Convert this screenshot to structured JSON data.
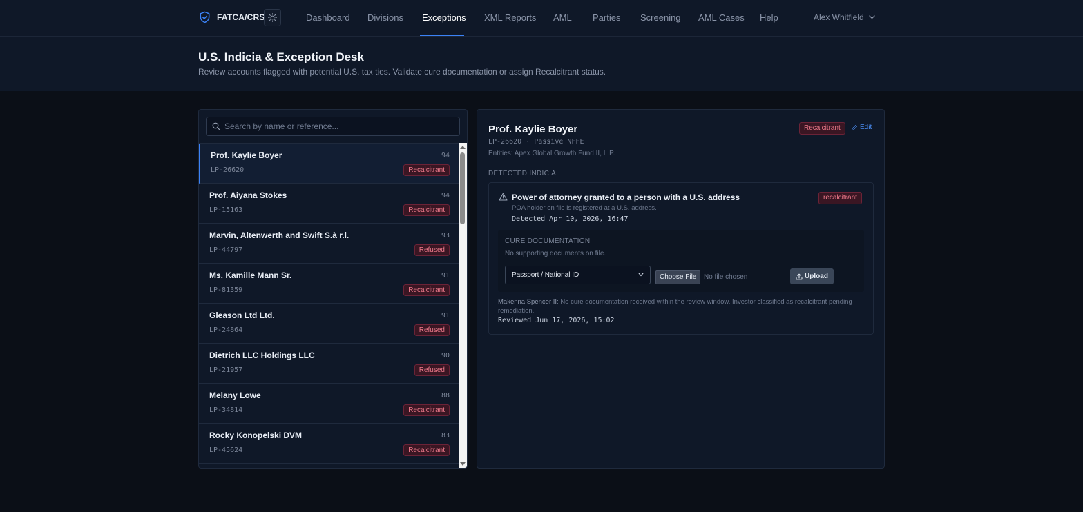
{
  "app": {
    "brand": "FATCA/CRS"
  },
  "nav": {
    "items": [
      "Dashboard",
      "Divisions",
      "Exceptions",
      "XML Reports",
      "AML",
      "Parties",
      "Screening",
      "AML Cases",
      "Help"
    ],
    "active": "Exceptions",
    "user": "Alex Whitfield"
  },
  "header": {
    "title": "U.S. Indicia & Exception Desk",
    "subtitle": "Review accounts flagged with potential U.S. tax ties. Validate cure documentation or assign Recalcitrant status."
  },
  "search": {
    "placeholder": "Search by name or reference...",
    "value": ""
  },
  "list": [
    {
      "name": "Prof. Kaylie Boyer",
      "ref": "LP-26620",
      "score": "94",
      "status": "Recalcitrant"
    },
    {
      "name": "Prof. Aiyana Stokes",
      "ref": "LP-15163",
      "score": "94",
      "status": "Recalcitrant"
    },
    {
      "name": "Marvin, Altenwerth and Swift S.à r.l.",
      "ref": "LP-44797",
      "score": "93",
      "status": "Refused"
    },
    {
      "name": "Ms. Kamille Mann Sr.",
      "ref": "LP-81359",
      "score": "91",
      "status": "Recalcitrant"
    },
    {
      "name": "Gleason Ltd Ltd.",
      "ref": "LP-24864",
      "score": "91",
      "status": "Refused"
    },
    {
      "name": "Dietrich LLC Holdings LLC",
      "ref": "LP-21957",
      "score": "90",
      "status": "Refused"
    },
    {
      "name": "Melany Lowe",
      "ref": "LP-34814",
      "score": "88",
      "status": "Recalcitrant"
    },
    {
      "name": "Rocky Konopelski DVM",
      "ref": "LP-45624",
      "score": "83",
      "status": "Recalcitrant"
    }
  ],
  "detail": {
    "name": "Prof. Kaylie Boyer",
    "ref_line": "LP-26620 · Passive NFFE",
    "entities": "Entities: Apex Global Growth Fund II, L.P.",
    "status": "Recalcitrant",
    "edit_label": "Edit",
    "section_label": "DETECTED INDICIA",
    "indicia": {
      "title": "Power of attorney granted to a person with a U.S. address",
      "badge": "recalcitrant",
      "description": "POA holder on file is registered at a U.S. address.",
      "detected": "Detected Apr 10, 2026, 16:47"
    },
    "cure": {
      "title": "CURE DOCUMENTATION",
      "empty": "No supporting documents on file.",
      "doc_type": "Passport / National ID",
      "choose_file": "Choose File",
      "file_status": "No file chosen",
      "upload": "Upload"
    },
    "review": {
      "reviewer": "Makenna Spencer II:",
      "note": "No cure documentation received within the review window. Investor classified as recalcitrant pending remediation.",
      "reviewed_at": "Reviewed Jun 17, 2026, 15:02"
    }
  },
  "colors": {
    "accent": "#3b82f6",
    "danger_text": "#f07a8c",
    "danger_bg": "#3a1623",
    "panel_bg": "#0f1828",
    "page_bg": "#0b0f17"
  }
}
